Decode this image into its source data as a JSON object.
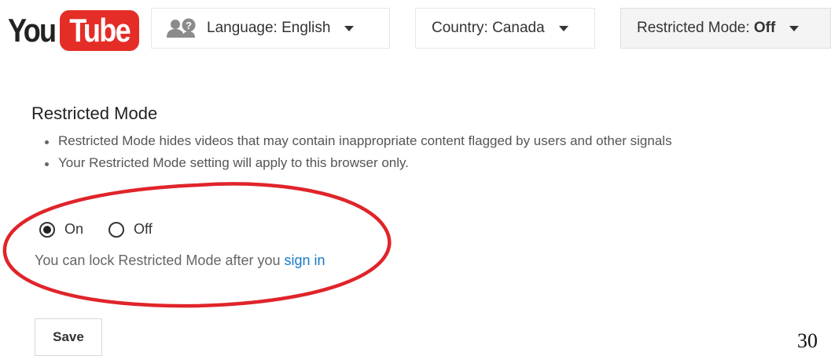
{
  "logo": {
    "you": "You",
    "tube": "Tube",
    "tube_color": "#e52d27"
  },
  "toolbar": {
    "language": {
      "label": "Language: English",
      "icon": "people-help-icon"
    },
    "country": {
      "label": "Country: Canada"
    },
    "restricted": {
      "prefix": "Restricted Mode: ",
      "value": "Off"
    }
  },
  "restricted_section": {
    "title": "Restricted Mode",
    "bullets": [
      "Restricted Mode hides videos that may contain inappropriate content flagged by users and other signals",
      "Your Restricted Mode setting will apply to this browser only."
    ],
    "options": [
      {
        "label": "On",
        "selected": true
      },
      {
        "label": "Off",
        "selected": false
      }
    ],
    "lock_text": "You can lock Restricted Mode after you ",
    "sign_in_link": "sign in",
    "save_label": "Save"
  },
  "annotation": {
    "color": "#e0242a"
  },
  "page_number": "30",
  "colors": {
    "link": "#167ac6",
    "text": "#333333"
  }
}
